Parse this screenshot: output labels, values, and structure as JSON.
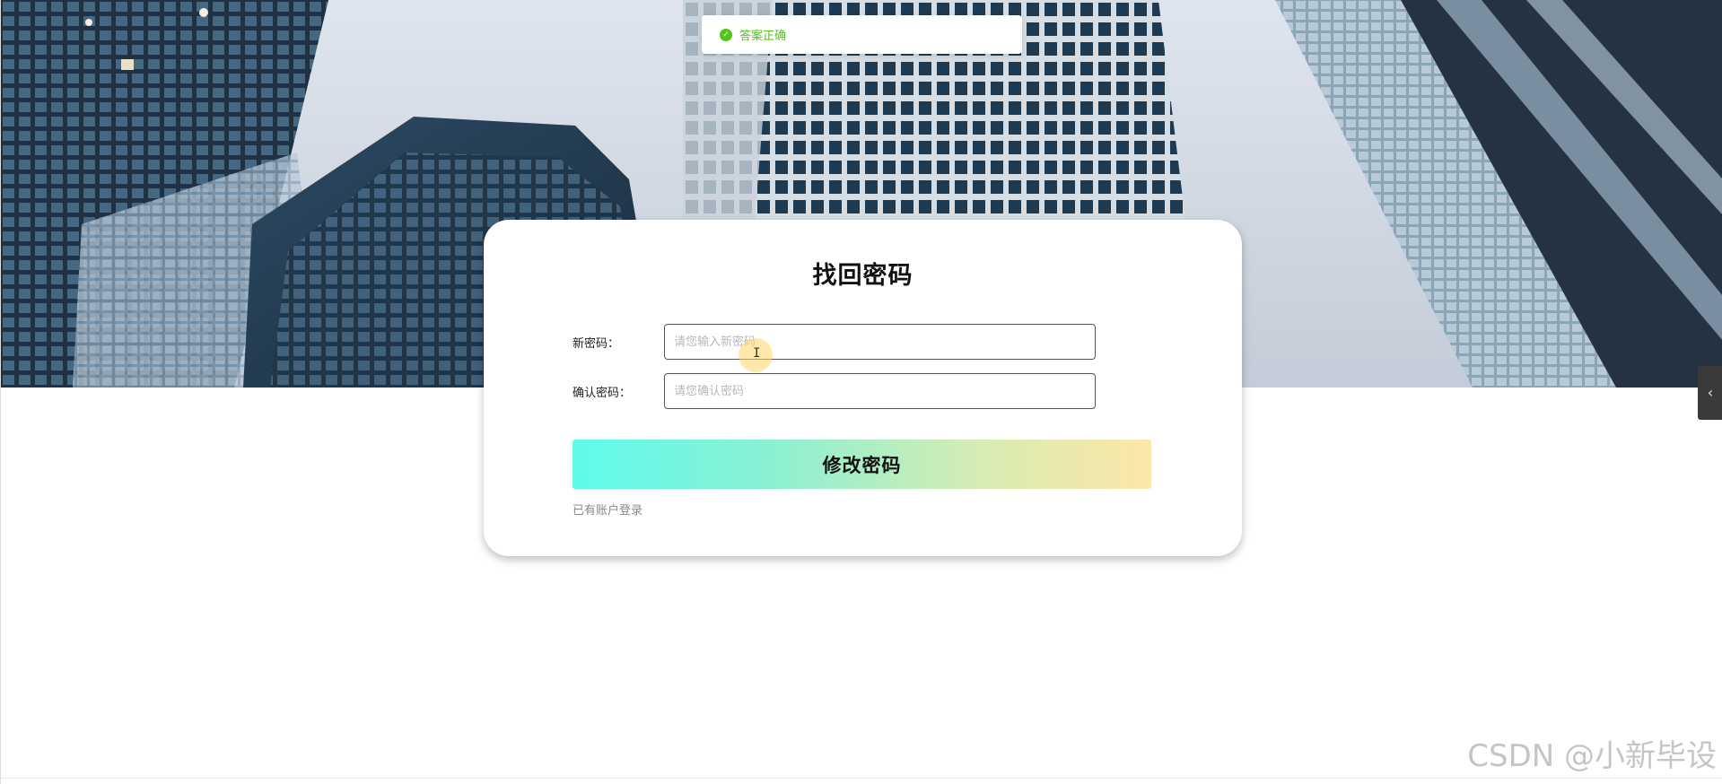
{
  "toast": {
    "icon": "check-circle-icon",
    "text": "答案正确",
    "color": "#52c41a"
  },
  "form": {
    "title": "找回密码",
    "new_password": {
      "label": "新密码：",
      "placeholder": "请您输入新密码"
    },
    "confirm_password": {
      "label": "确认密码：",
      "placeholder": "请您确认密码"
    },
    "submit_label": "修改密码",
    "login_link": "已有账户登录"
  },
  "side_tab": {
    "icon": "chevron-left-icon",
    "glyph": "‹"
  },
  "watermark": "CSDN @小新毕设",
  "colors": {
    "button_gradient_start": "#5ffbeb",
    "button_gradient_end": "#fde6a8",
    "success": "#52c41a"
  }
}
